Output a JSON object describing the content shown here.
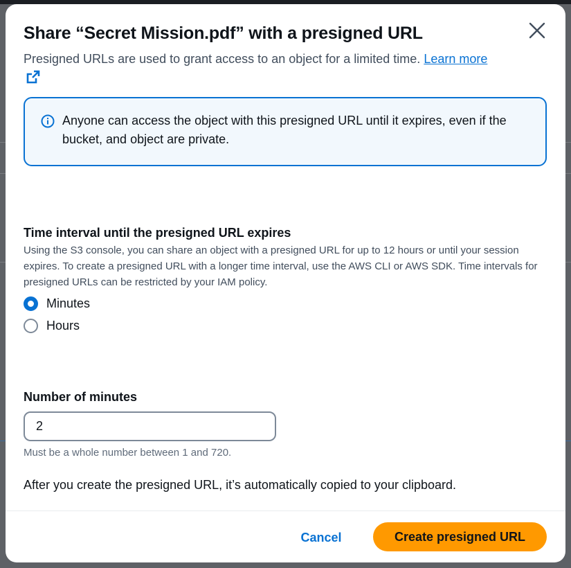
{
  "modal": {
    "title": "Share “Secret Mission.pdf” with a presigned URL",
    "description": "Presigned URLs are used to grant access to an object for a limited time.",
    "learn_more": "Learn more"
  },
  "alert": {
    "icon": "info-icon",
    "text": "Anyone can access the object with this presigned URL until it expires, even if the bucket, and object are private."
  },
  "time_interval": {
    "label": "Time interval until the presigned URL expires",
    "description": "Using the S3 console, you can share an object with a presigned URL for up to 12 hours or until your session expires. To create a presigned URL with a longer time interval, use the AWS CLI or AWS SDK. Time intervals for presigned URLs can be restricted by your IAM policy.",
    "options": [
      {
        "label": "Minutes",
        "selected": true
      },
      {
        "label": "Hours",
        "selected": false
      }
    ]
  },
  "minutes": {
    "label": "Number of minutes",
    "value": "2",
    "constraint": "Must be a whole number between 1 and 720."
  },
  "note": "After you create the presigned URL, it’s automatically copied to your clipboard.",
  "buttons": {
    "cancel": "Cancel",
    "create": "Create presigned URL"
  },
  "colors": {
    "primary": "#ff9900",
    "link": "#0972d3",
    "alert_bg": "#f2f8fd"
  }
}
